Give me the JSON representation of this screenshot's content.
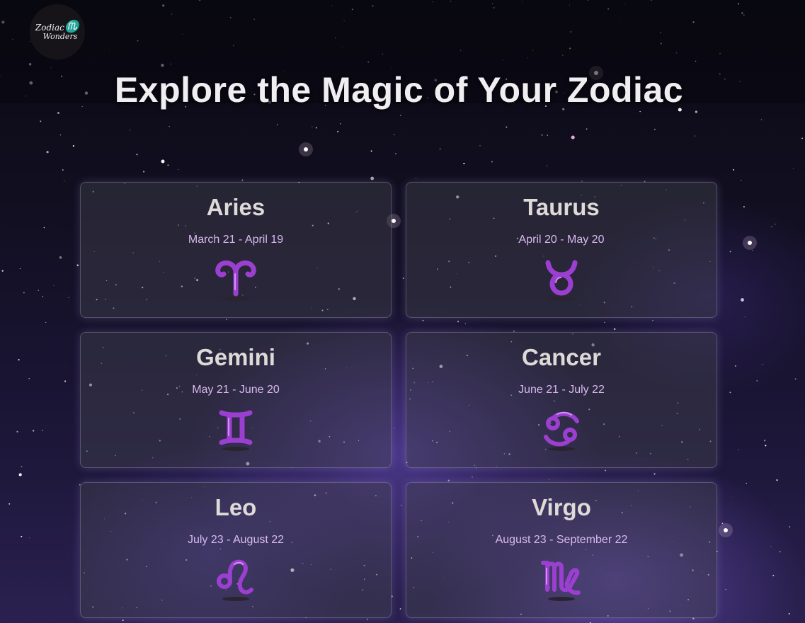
{
  "logo": {
    "line1": "Zodiac",
    "mark": "♏",
    "line2": "Wonders"
  },
  "title": "Explore the Magic of Your Zodiac",
  "colors": {
    "accent": "#9b3fd0",
    "card_text": "#dedad8",
    "date_text": "#d9b8ee"
  },
  "signs": [
    {
      "name": "Aries",
      "dates": "March 21 - April 19",
      "icon": "aries-icon"
    },
    {
      "name": "Taurus",
      "dates": "April 20 - May 20",
      "icon": "taurus-icon"
    },
    {
      "name": "Gemini",
      "dates": "May 21 - June 20",
      "icon": "gemini-icon"
    },
    {
      "name": "Cancer",
      "dates": "June 21 - July 22",
      "icon": "cancer-icon"
    },
    {
      "name": "Leo",
      "dates": "July 23 - August 22",
      "icon": "leo-icon"
    },
    {
      "name": "Virgo",
      "dates": "August 23 - September 22",
      "icon": "virgo-icon"
    }
  ]
}
